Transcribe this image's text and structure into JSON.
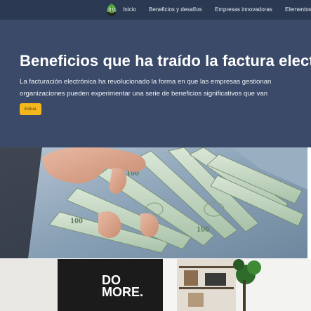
{
  "nav": {
    "logo_icon": "leaf-frog-logo-icon",
    "links": [
      "Inicio",
      "Beneficios y desafíos",
      "Empresas innovadoras",
      "Elementos"
    ]
  },
  "hero": {
    "title": "Beneficios que ha traído la factura electrónica",
    "text_line1": "La facturación electrónica ha revolucionado la forma en que las empresas gestionan",
    "text_line2": "organizaciones pueden experimentar una serie de beneficios significativos que van",
    "edit_label": "Editar"
  },
  "images": {
    "money": "hands-counting-dollar-bills-photo",
    "office": "office-desk-do-more-poster-photo"
  },
  "poster": {
    "line1": "DO",
    "line2": "MORE."
  },
  "colors": {
    "navbar": "#2b3a52",
    "hero": "#3a4a68",
    "button": "#f5b81c"
  }
}
